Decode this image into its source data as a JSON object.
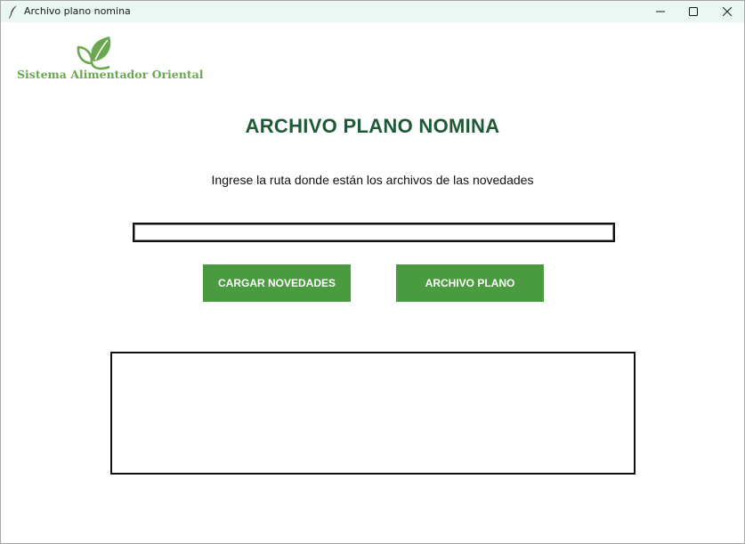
{
  "window": {
    "title": "Archivo plano nomina",
    "controls": [
      "minimize",
      "maximize",
      "close"
    ]
  },
  "logo": {
    "text": "Sistema Alimentador Oriental",
    "icon": "leaf-icon",
    "color": "#6aa84f"
  },
  "header": {
    "title": "ARCHIVO PLANO NOMINA",
    "color": "#1e5a37"
  },
  "form": {
    "instruction": "Ingrese la ruta donde están los archivos de las novedades",
    "path_value": "",
    "output_text": ""
  },
  "buttons": {
    "cargar_label": "CARGAR NOVEDADES",
    "plano_label": "ARCHIVO PLANO",
    "color": "#4a9a3f"
  }
}
